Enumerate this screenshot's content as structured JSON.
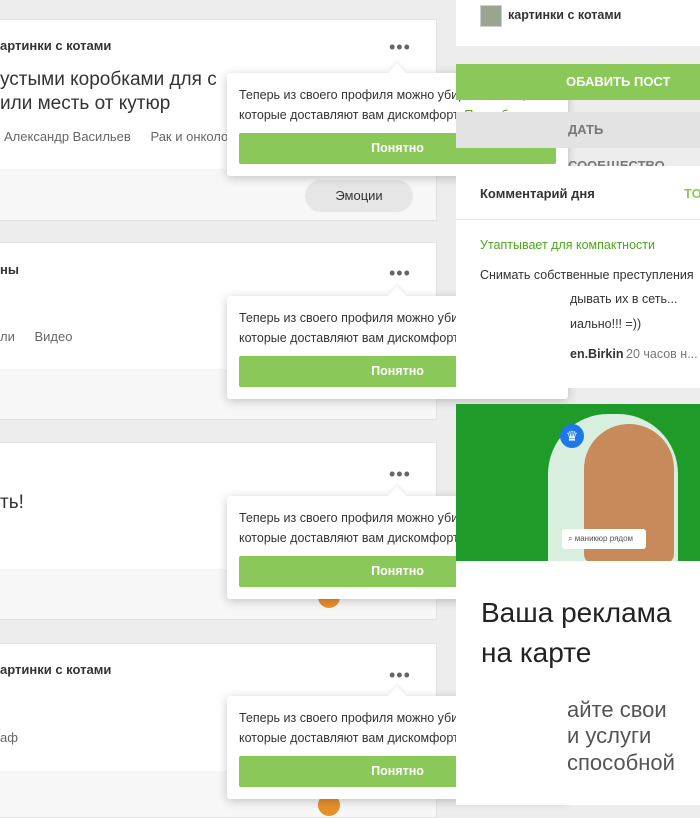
{
  "feed": {
    "posts": [
      {
        "author": "артинки с котами",
        "title_line1": "устыми коробками для с",
        "title_line2": "или месть от кутюр",
        "tags": [
          "Александр Васильев",
          "Рак и онколо"
        ],
        "reaction_label": "Эмоции"
      },
      {
        "author": "ны",
        "tags": [
          "ли",
          "Видео"
        ]
      },
      {
        "text": "ть!"
      },
      {
        "author": "артинки с котами",
        "tags": [
          "аф"
        ]
      }
    ],
    "popup": {
      "text": "Теперь из своего профиля можно убирать посты, которые доставляют вам дискомфорт.",
      "more_link": "Подробнее",
      "button": "Понятно"
    }
  },
  "sidebar": {
    "group_name": "картинки с котами",
    "add_post": "ОБАВИТЬ ПОСТ",
    "create_community": "ДАТЬ СООБЩЕСТВО",
    "comment_of_day": {
      "heading": "Комментарий дня",
      "tab": "ТО",
      "post_title": "Утаптывает для компактности",
      "text_line1": "Снимать собственные преступления",
      "text_line2": "дывать их в сеть...",
      "text_line3": "иально!!! =))",
      "user": "en.Birkin",
      "time": "20 часов н..."
    },
    "ad": {
      "search_text": "маникюр рядом",
      "headline_line1": "Ваша реклама",
      "headline_line2": "на карте",
      "body_line1": "айте свои",
      "body_line2": "и услуги",
      "body_line3": "способной"
    }
  },
  "colors": {
    "accent_green": "#8ac959",
    "link_green": "#4ca81d",
    "ad_green": "#1e9b29"
  }
}
